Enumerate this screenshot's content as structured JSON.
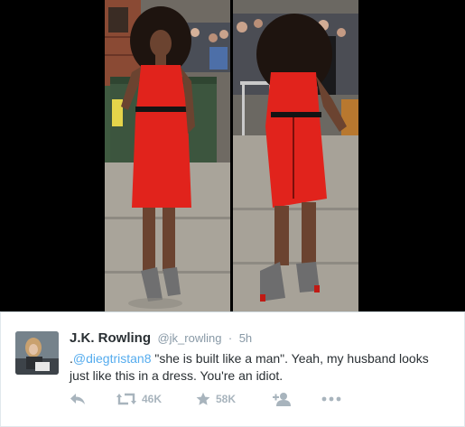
{
  "media": {
    "label": "Tweet photo of a woman in a red dress"
  },
  "tweet": {
    "author_name": "J.K. Rowling",
    "handle": "@jk_rowling",
    "separator": "·",
    "timestamp": "5h",
    "text_prefix": ".",
    "mention": "@diegtristan8",
    "text_body": " \"she is built like a man\". Yeah, my husband looks just like this in a dress. You're an idiot.",
    "retweet_count": "46K",
    "favorite_count": "58K"
  },
  "icons": {
    "reply": "reply-icon",
    "retweet": "retweet-icon",
    "favorite": "star-icon",
    "follow": "add-user-icon",
    "more": "more-icon"
  },
  "colors": {
    "mention": "#55acee",
    "action_gray": "#a8b4bd",
    "name": "#292f33",
    "meta": "#8899a6",
    "dress": "#e1231c"
  }
}
